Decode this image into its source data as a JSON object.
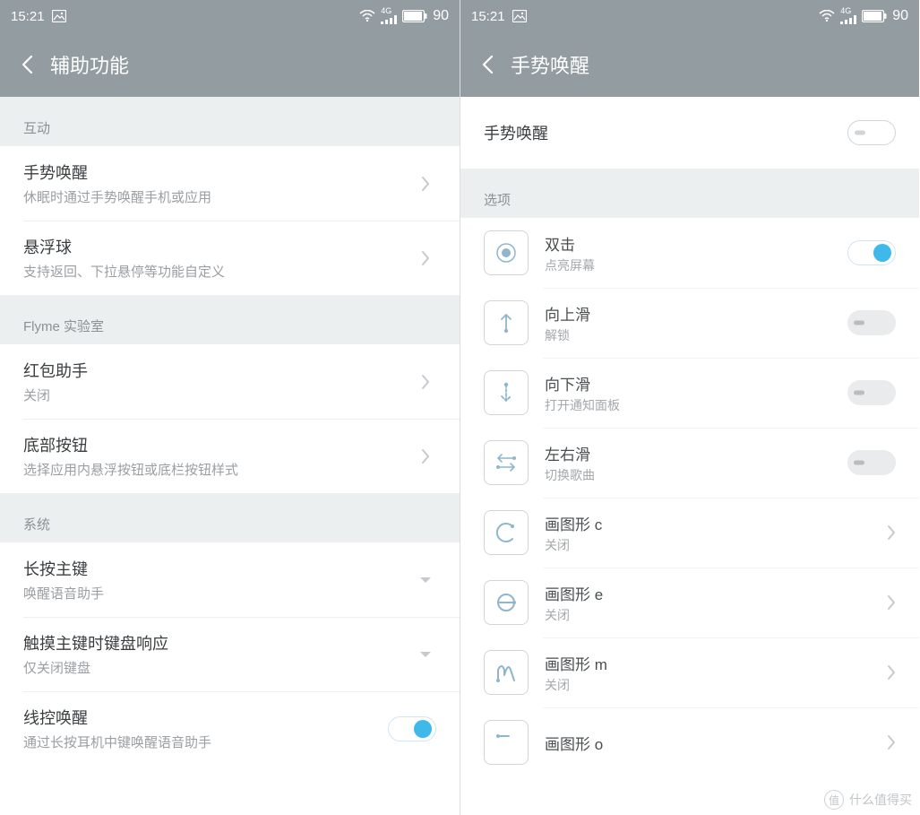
{
  "status": {
    "time": "15:21",
    "battery": "90"
  },
  "left": {
    "title": "辅助功能",
    "sections": [
      {
        "header": "互动",
        "rows": [
          {
            "t1": "手势唤醒",
            "t2": "休眠时通过手势唤醒手机或应用",
            "acc": "chev"
          },
          {
            "t1": "悬浮球",
            "t2": "支持返回、下拉悬停等功能自定义",
            "acc": "chev"
          }
        ]
      },
      {
        "header": "Flyme 实验室",
        "rows": [
          {
            "t1": "红包助手",
            "t2": "关闭",
            "acc": "chev"
          },
          {
            "t1": "底部按钮",
            "t2": "选择应用内悬浮按钮或底栏按钮样式",
            "acc": "chev"
          }
        ]
      },
      {
        "header": "系统",
        "rows": [
          {
            "t1": "长按主键",
            "t2": "唤醒语音助手",
            "acc": "drop"
          },
          {
            "t1": "触摸主键时键盘响应",
            "t2": "仅关闭键盘",
            "acc": "drop"
          },
          {
            "t1": "线控唤醒",
            "t2": "通过长按耳机中键唤醒语音助手",
            "acc": "toggle-on"
          }
        ]
      }
    ]
  },
  "right": {
    "title": "手势唤醒",
    "master": {
      "label": "手势唤醒",
      "state": "off"
    },
    "section_header": "选项",
    "options": [
      {
        "icon": "doubletap",
        "t1": "双击",
        "t2": "点亮屏幕",
        "acc": "toggle-on"
      },
      {
        "icon": "up",
        "t1": "向上滑",
        "t2": "解锁",
        "acc": "toggle-off"
      },
      {
        "icon": "down",
        "t1": "向下滑",
        "t2": "打开通知面板",
        "acc": "toggle-off"
      },
      {
        "icon": "lr",
        "t1": "左右滑",
        "t2": "切换歌曲",
        "acc": "toggle-off"
      },
      {
        "icon": "c",
        "t1": "画图形 c",
        "t2": "关闭",
        "acc": "chev"
      },
      {
        "icon": "e",
        "t1": "画图形 e",
        "t2": "关闭",
        "acc": "chev"
      },
      {
        "icon": "m",
        "t1": "画图形 m",
        "t2": "关闭",
        "acc": "chev"
      },
      {
        "icon": "o",
        "t1": "画图形 o",
        "t2": "",
        "acc": "chev"
      }
    ]
  },
  "watermark": "什么值得买"
}
